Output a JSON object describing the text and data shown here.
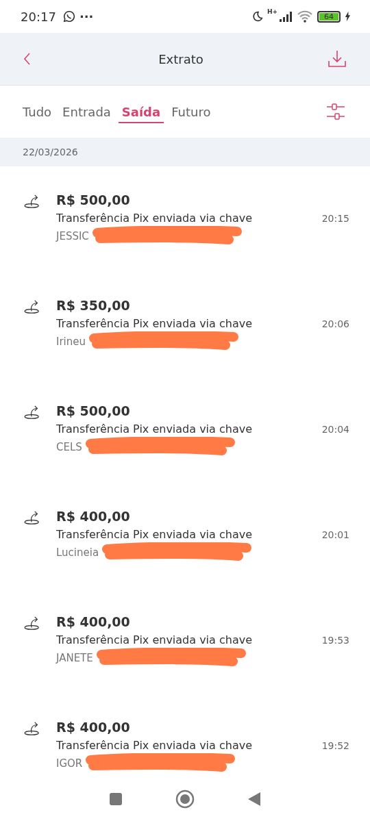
{
  "status_bar": {
    "time": "20:17",
    "dots": "···",
    "network": "H+",
    "battery": "64"
  },
  "header": {
    "title": "Extrato"
  },
  "tabs": [
    {
      "label": "Tudo",
      "selected": false
    },
    {
      "label": "Entrada",
      "selected": false
    },
    {
      "label": "Saída",
      "selected": true
    },
    {
      "label": "Futuro",
      "selected": false
    }
  ],
  "date": "22/03/2026",
  "transactions": [
    {
      "amount": "R$ 500,00",
      "description": "Transferência Pix enviada via chave",
      "name": "JESSIC",
      "time": "20:15",
      "redacted": true
    },
    {
      "amount": "R$ 350,00",
      "description": "Transferência Pix enviada via chave",
      "name": "Irineu",
      "time": "20:06",
      "redacted": true
    },
    {
      "amount": "R$ 500,00",
      "description": "Transferência Pix enviada via chave",
      "name": "CELS",
      "time": "20:04",
      "redacted": true
    },
    {
      "amount": "R$ 400,00",
      "description": "Transferência Pix enviada via chave",
      "name": "Lucineia",
      "time": "20:01",
      "redacted": true
    },
    {
      "amount": "R$ 400,00",
      "description": "Transferência Pix enviada via chave",
      "name": "JANETE",
      "time": "19:53",
      "redacted": true
    },
    {
      "amount": "R$ 400,00",
      "description": "Transferência Pix enviada via chave",
      "name": "IGOR",
      "time": "19:52",
      "redacted": true
    }
  ]
}
